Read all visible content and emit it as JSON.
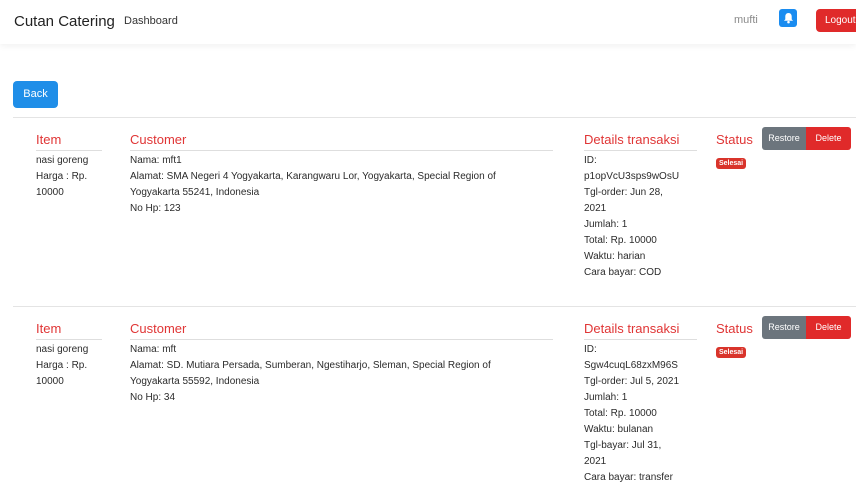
{
  "navbar": {
    "brand": "Cutan Catering",
    "dashboard": "Dashboard",
    "user": "mufti",
    "logout": "Logout"
  },
  "actions": {
    "back": "Back"
  },
  "headers": {
    "item": "Item",
    "customer": "Customer",
    "details": "Details transaksi",
    "status": "Status"
  },
  "buttons": {
    "restore": "Restore",
    "delete": "Delete"
  },
  "orders": [
    {
      "item_name": "nasi goreng",
      "item_price_lines": [
        "Harga : Rp.",
        "10000"
      ],
      "cust_name": "Nama: mft1",
      "cust_address_lines": [
        "Alamat: SMA Negeri 4 Yogyakarta, Karangwaru Lor, Yogyakarta, Special Region of",
        "Yogyakarta 55241, Indonesia"
      ],
      "cust_phone": "No Hp: 123",
      "details": [
        "ID:",
        "p1opVcU3sps9wOsU",
        "Tgl-order: Jun 28,",
        "2021",
        "Jumlah: 1",
        "Total: Rp. 10000",
        "Waktu: harian",
        "Cara bayar: COD"
      ],
      "status": "Selesai"
    },
    {
      "item_name": "nasi goreng",
      "item_price_lines": [
        "Harga : Rp.",
        "10000"
      ],
      "cust_name": "Nama: mft",
      "cust_address_lines": [
        "Alamat: SD. Mutiara Persada, Sumberan, Ngestiharjo, Sleman, Special Region of",
        "Yogyakarta 55592, Indonesia"
      ],
      "cust_phone": "No Hp: 34",
      "details": [
        "ID:",
        "Sgw4cuqL68zxM96S",
        "Tgl-order: Jul 5, 2021",
        "Jumlah: 1",
        "Total: Rp. 10000",
        "Waktu: bulanan",
        "Tgl-bayar: Jul 31,",
        "2021",
        "Cara bayar: transfer"
      ],
      "status": "Selesai"
    }
  ]
}
